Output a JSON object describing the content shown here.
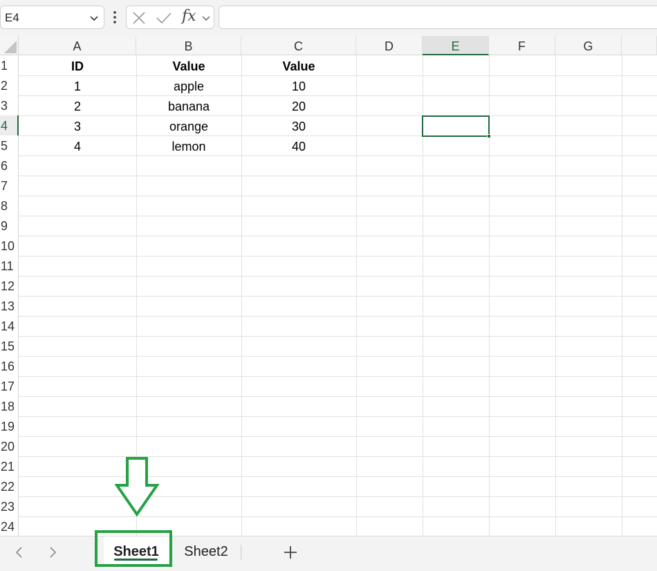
{
  "formula_bar": {
    "name_box": "E4",
    "fx_label": "fx",
    "formula_value": ""
  },
  "columns": [
    "A",
    "B",
    "C",
    "D",
    "E",
    "F",
    "G"
  ],
  "selected_column": "E",
  "rows": [
    "1",
    "2",
    "3",
    "4",
    "5",
    "6",
    "7",
    "8",
    "9",
    "10",
    "11",
    "12",
    "13",
    "14",
    "15",
    "16",
    "17",
    "18",
    "19",
    "20",
    "21",
    "22",
    "23",
    "24"
  ],
  "selected_row": "4",
  "cells": {
    "header": [
      "ID",
      "Value",
      "Value"
    ],
    "data": [
      [
        "1",
        "apple",
        "10"
      ],
      [
        "2",
        "banana",
        "20"
      ],
      [
        "3",
        "orange",
        "30"
      ],
      [
        "4",
        "lemon",
        "40"
      ]
    ]
  },
  "sheet_tabs": {
    "tabs": [
      "Sheet1",
      "Sheet2"
    ],
    "active": "Sheet1",
    "add_label": "+"
  },
  "colors": {
    "accent": "#1e6b3c",
    "annotation": "#25a244"
  }
}
